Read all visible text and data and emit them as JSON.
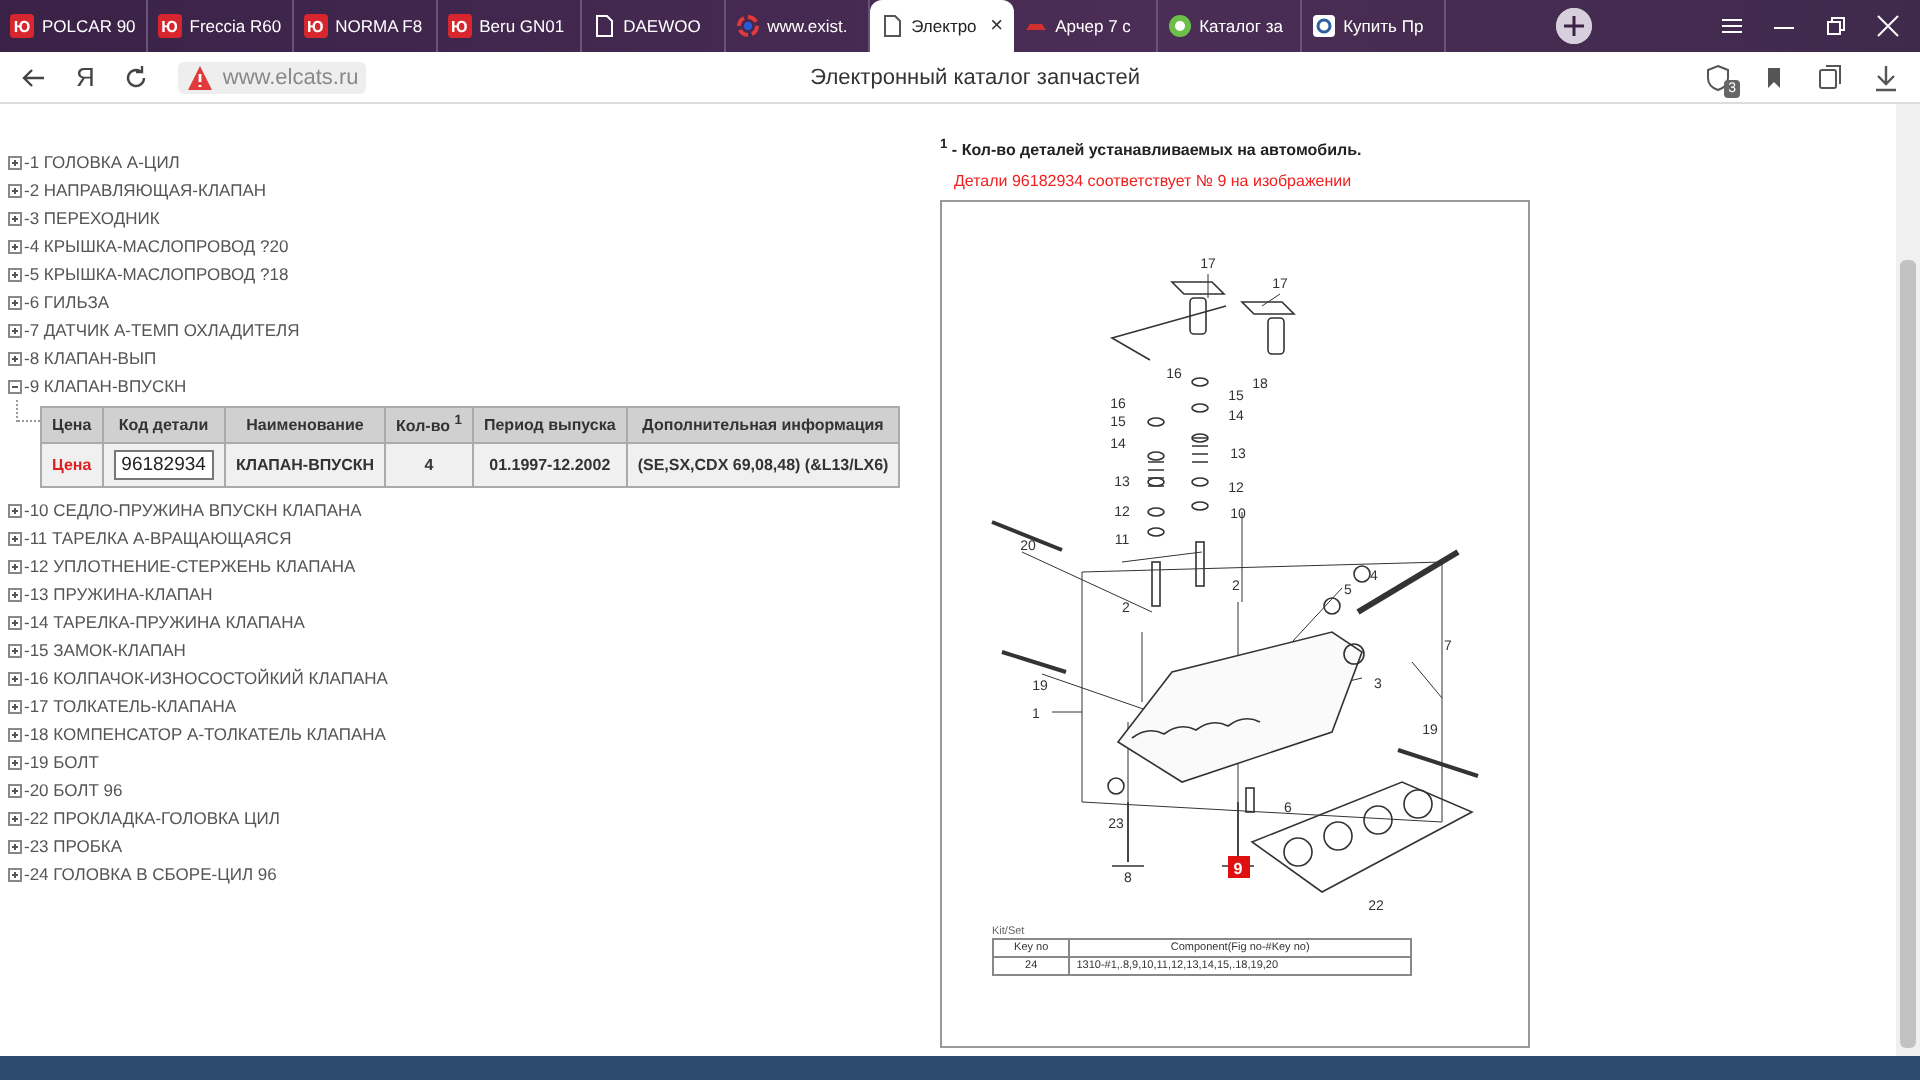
{
  "tabs": [
    {
      "kind": "brand",
      "logo": "Ю",
      "label": "POLCAR 90",
      "selected": false
    },
    {
      "kind": "brand",
      "logo": "Ю",
      "label": "Freccia R60",
      "selected": false
    },
    {
      "kind": "brand",
      "logo": "Ю",
      "label": "NORMA F8",
      "selected": false
    },
    {
      "kind": "brand",
      "logo": "Ю",
      "label": "Beru GN01",
      "selected": false
    },
    {
      "kind": "page",
      "label": "DAEWOO",
      "selected": false
    },
    {
      "kind": "swirl",
      "label": "www.exist.",
      "selected": false
    },
    {
      "kind": "page",
      "label": "Электро",
      "selected": true,
      "close": "×"
    },
    {
      "kind": "car",
      "label": "Арчер 7 с",
      "selected": false
    },
    {
      "kind": "ring",
      "label": "Каталог за",
      "selected": false
    },
    {
      "kind": "square",
      "label": "Купить Пр",
      "selected": false
    }
  ],
  "address_bar": {
    "logo": "Я",
    "url": "www.elcats.ru",
    "page_title": "Электронный каталог запчастей",
    "shield_badge": "3"
  },
  "tree": [
    {
      "label": "-1 ГОЛОВКА А-ЦИЛ",
      "expanded": false
    },
    {
      "label": "-2 НАПРАВЛЯЮЩАЯ-КЛАПАН",
      "expanded": false
    },
    {
      "label": "-3 ПЕРЕХОДНИК",
      "expanded": false
    },
    {
      "label": "-4 КРЫШКА-МАСЛОПРОВОД ?20",
      "expanded": false
    },
    {
      "label": "-5 КРЫШКА-МАСЛОПРОВОД ?18",
      "expanded": false
    },
    {
      "label": "-6 ГИЛЬЗА",
      "expanded": false
    },
    {
      "label": "-7 ДАТЧИК А-ТЕМП ОХЛАДИТЕЛЯ",
      "expanded": false
    },
    {
      "label": "-8 КЛАПАН-ВЫП",
      "expanded": false
    },
    {
      "label": "-9 КЛАПАН-ВПУСКН",
      "expanded": true,
      "parts_table": {
        "columns": [
          "Цена",
          "Код детали",
          "Наименование",
          "Кол-во $^{1}$",
          "Период выпуска",
          "Дополнительная информация"
        ],
        "rows": [
          {
            "price_link": "Цена",
            "code": "96182934",
            "name": "КЛАПАН-ВПУСКН",
            "quantity": "4",
            "period": "01.1997-12.2002",
            "info": "(SE,SX,CDX 69,08,48) (&L13/LX6)"
          }
        ]
      }
    },
    {
      "label": "-10 СЕДЛО-ПРУЖИНА ВПУСКН КЛАПАНА",
      "expanded": false
    },
    {
      "label": "-11 ТАРЕЛКА А-ВРАЩАЮЩАЯСЯ",
      "expanded": false
    },
    {
      "label": "-12 УПЛОТНЕНИЕ-СТЕРЖЕНЬ КЛАПАНА",
      "expanded": false
    },
    {
      "label": "-13 ПРУЖИНА-КЛАПАН",
      "expanded": false
    },
    {
      "label": "-14 ТАРЕЛКА-ПРУЖИНА КЛАПАНА",
      "expanded": false
    },
    {
      "label": "-15 ЗАМОК-КЛАПАН",
      "expanded": false
    },
    {
      "label": "-16 КОЛПАЧОК-ИЗНОСОСТОЙКИЙ КЛАПАНА",
      "expanded": false
    },
    {
      "label": "-17 ТОЛКАТЕЛЬ-КЛАПАНА",
      "expanded": false
    },
    {
      "label": "-18 КОМПЕНСАТОР А-ТОЛКАТЕЛЬ КЛАПАНА",
      "expanded": false
    },
    {
      "label": "-19 БОЛТ",
      "expanded": false
    },
    {
      "label": "-20 БОЛТ 96",
      "expanded": false
    },
    {
      "label": "-22 ПРОКЛАДКА-ГОЛОВКА ЦИЛ",
      "expanded": false
    },
    {
      "label": "-23 ПРОБКА",
      "expanded": false
    },
    {
      "label": "-24 ГОЛОВКА В СБОРЕ-ЦИЛ 96",
      "expanded": false
    }
  ],
  "diagram_panel": {
    "footnote": "$^{1}$ - Кол-во деталей устанавливаемых на автомобиль.",
    "match_note": "Детали 96182934 соответствует № 9 на изображении",
    "callouts": [
      {
        "label": "17",
        "highlighted": false
      },
      {
        "label": "17",
        "highlighted": false
      },
      {
        "label": "16",
        "highlighted": false
      },
      {
        "label": "18",
        "highlighted": false
      },
      {
        "label": "15",
        "highlighted": false
      },
      {
        "label": "16",
        "highlighted": false
      },
      {
        "label": "15",
        "highlighted": false
      },
      {
        "label": "14",
        "highlighted": false
      },
      {
        "label": "14",
        "highlighted": false
      },
      {
        "label": "13",
        "highlighted": false
      },
      {
        "label": "13",
        "highlighted": false
      },
      {
        "label": "12",
        "highlighted": false
      },
      {
        "label": "12",
        "highlighted": false
      },
      {
        "label": "10",
        "highlighted": false
      },
      {
        "label": "11",
        "highlighted": false
      },
      {
        "label": "20",
        "highlighted": false
      },
      {
        "label": "2",
        "highlighted": false
      },
      {
        "label": "2",
        "highlighted": false
      },
      {
        "label": "5",
        "highlighted": false
      },
      {
        "label": "4",
        "highlighted": false
      },
      {
        "label": "7",
        "highlighted": false
      },
      {
        "label": "19",
        "highlighted": false
      },
      {
        "label": "3",
        "highlighted": false
      },
      {
        "label": "1",
        "highlighted": false
      },
      {
        "label": "19",
        "highlighted": false
      },
      {
        "label": "6",
        "highlighted": false
      },
      {
        "label": "23",
        "highlighted": false
      },
      {
        "label": "8",
        "highlighted": false
      },
      {
        "label": "9",
        "highlighted": true
      },
      {
        "label": "22",
        "highlighted": false
      }
    ],
    "kit_table": {
      "title": "Kit/Set",
      "columns": [
        "Key no",
        "Component(Fig no-#Key no)"
      ],
      "rows": [
        [
          "24",
          "1310-#1,.8,9,10,11,12,13,14,15,.18,19,20"
        ]
      ]
    }
  }
}
